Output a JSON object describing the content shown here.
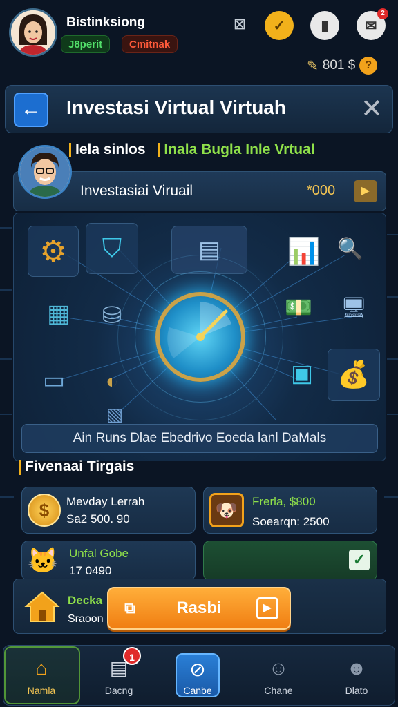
{
  "profile": {
    "name": "Bistinksiong",
    "tag_green": "J8perit",
    "tag_red": "Cmitnak",
    "balance_text": "801 $",
    "coin_symbol": "?"
  },
  "header": {
    "back_symbol": "←",
    "title": "Investasi Virtual Virtuah",
    "close_symbol": "✕"
  },
  "guide": {
    "line_white": "Iela sinlos",
    "line_green": "Inala Bugla Inle Vrtual"
  },
  "invest_bar": {
    "label": "Investasiai Viruail",
    "amount": "*000"
  },
  "caption": "Ain Runs Dlae Ebedrivo Eoeda lanl DaMals",
  "section_title": "Fivenaai Tirgais",
  "cards": [
    {
      "title": "Mevday Lerrah",
      "value": "Sa2 500. 90"
    },
    {
      "title": "Frerla, $800",
      "value": "Soearqn: 2500"
    },
    {
      "title": "Unfal Gobe",
      "value": "17 0490"
    },
    {
      "title": "",
      "value": ""
    }
  ],
  "action": {
    "text1": "Decka",
    "text2": "Sraoon",
    "cta_label": "Rasbi"
  },
  "nav": [
    {
      "label": "Namla",
      "icon": "home-icon"
    },
    {
      "label": "Dacng",
      "icon": "calendar-icon",
      "badge": "1"
    },
    {
      "label": "Canbe",
      "icon": "compass-icon"
    },
    {
      "label": "Chane",
      "icon": "user-icon"
    },
    {
      "label": "Dlato",
      "icon": "group-icon"
    }
  ],
  "colors": {
    "accent": "#f2b11b",
    "cta": "#f07e12",
    "green": "#8fe04a",
    "background": "#0b1524"
  }
}
